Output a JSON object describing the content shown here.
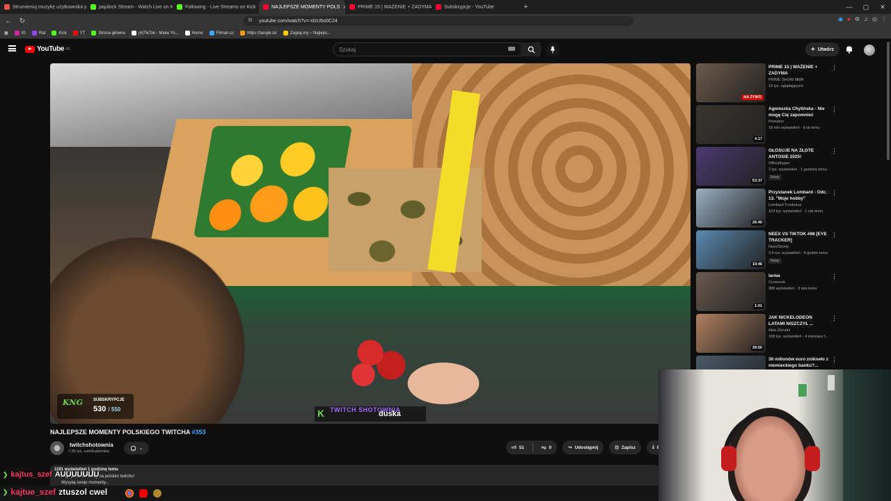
{
  "browser": {
    "tabs": [
      {
        "label": "Strumieniuj muzykę użytkownika jnu",
        "color": "#e8554a"
      },
      {
        "label": "pajulock Stream - Watch Live on Kick",
        "color": "#53fc18"
      },
      {
        "label": "Following - Live Streams on Kick",
        "color": "#53fc18"
      },
      {
        "label": "NAJLEPSZE MOMENTY POLS",
        "color": "#ff0033",
        "active": true
      },
      {
        "label": "PRIME 15 | WAŻENIE + ZADYMA - Yo",
        "color": "#ff0033"
      },
      {
        "label": "Subskrypcje - YouTube",
        "color": "#ff0033"
      }
    ],
    "new_tab": "+",
    "url": "youtube.com/watch?v=-xfzU6o0C24",
    "bookmarks": [
      {
        "label": "IG",
        "color": "#d6249f"
      },
      {
        "label": "Rat",
        "color": "#9146ff"
      },
      {
        "label": "Kick",
        "color": "#53fc18"
      },
      {
        "label": "YT",
        "color": "#ff0000"
      },
      {
        "label": "Strona główna",
        "color": "#53fc18"
      },
      {
        "label": "(4)TikTok - Make Yo...",
        "color": "#ffffff"
      },
      {
        "label": "Home",
        "color": "#ffffff"
      },
      {
        "label": "Filman.cc",
        "color": "#3ea6ff"
      },
      {
        "label": "https://tangle.io/",
        "color": "#ff9900"
      },
      {
        "label": "Zagraj.my – Najleps...",
        "color": "#ffcc00"
      }
    ]
  },
  "header": {
    "logo_text": "YouTube",
    "logo_country": "PL",
    "search_placeholder": "Szukaj",
    "create_label": "Utwórz"
  },
  "video": {
    "subs_widget_label": "SUBSKRYPCJE",
    "subs_current": "530",
    "subs_goal": "/ 550",
    "overlay_brand": "TWITCH SHOTOWNIA",
    "overlay_name": "duska",
    "title": "NAJLEPSZE MOMENTY POLSKIEGO TWITCHA",
    "title_tag": "#353",
    "channel": "twitchshotownia",
    "channel_subs": "7,55 tys. subskrybentów",
    "likes": "51",
    "dislikes": "0",
    "share_label": "Udostępnij",
    "save_label": "Zapisz",
    "download_label": "Po"
  },
  "description": {
    "stats": "1191 wyświetleń  1 godzinę temu",
    "line2": "Najlepsze momenty na polskim twitchu!",
    "line3": "Wysyłaj swoje momenty..."
  },
  "recommendations": [
    {
      "title": "PRIME 15 | WAŻENIE + ZADYMA",
      "channel": "PRIME SHOW MMA",
      "meta": "19 tys. oglądających",
      "badge": "NA ŻYWO",
      "live": true,
      "thumb": "#6c5a4a"
    },
    {
      "title": "Agnieszka Chylińska - Nie mogę Cię zapomnieć",
      "channel": "Pomaton",
      "meta": "18 mln wyświetleń · 9 lat temu",
      "duration": "4:17",
      "thumb": "#3a3530"
    },
    {
      "title": "GŁOSUJE NA ZŁOTE ANTOSIE 2025!",
      "channel": "Officialhyper",
      "meta": "2 tys. wyświetleń · 1 godzinę temu",
      "duration": "53:37",
      "badge": "Nowy",
      "thumb": "#4a3a70"
    },
    {
      "title": "Przystanek Lombard - Odc. 13. \"Moje hobby\"",
      "channel": "Lombard Trzebnica",
      "meta": "103 tys. wyświetleń · 1 rok temu",
      "duration": "26:40",
      "thumb": "#9ab0c4"
    },
    {
      "title": "NEEX VS TIKTOK #98 [EYE TRACKER]",
      "channel": "NeexShorty",
      "meta": "3,4 tys. wyświetleń · 9 godzin temu",
      "duration": "19:46",
      "badge": "Nowy",
      "thumb": "#5a8ab0"
    },
    {
      "title": "larwa",
      "channel": "Cromerek",
      "meta": "388 wyświetleń · 3 lata temu",
      "duration": "1:01",
      "thumb": "#6a5a50"
    },
    {
      "title": "JAK NICKELODEON LATAMI NISZCZYŁ ...",
      "channel": "Akta Zbrodni",
      "meta": "108 tys. wyświetleń · 4 miesiące t...",
      "duration": "28:50",
      "thumb": "#b08060"
    },
    {
      "title": "30 milionów euro znikneło z niemieckiego banku?...",
      "channel": "",
      "meta": "",
      "thumb": "#4a5a6a"
    }
  ],
  "chat": {
    "line1_user": "kajtus_szef",
    "line1_msg": "AUUUUUUU",
    "line2_user": "kajtue_szef",
    "line2_msg": "ztuszol cwel"
  },
  "colors": {
    "accent": "#3ea6ff",
    "youtube_red": "#ff0000",
    "kick_green": "#53fc18",
    "chat_user": "#ff3a64"
  }
}
